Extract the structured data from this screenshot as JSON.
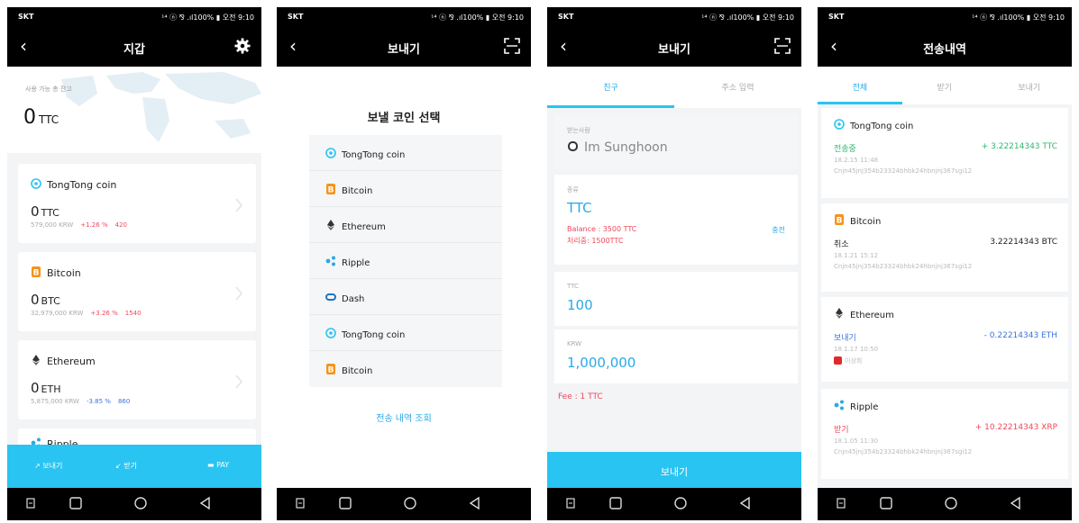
{
  "status_bar": {
    "carrier": "SKT",
    "system_info": "¹⁴ ⓝ ⅋ .ıl100% ▮ 오전 9:10"
  },
  "colors": {
    "accent": "#29c4f2",
    "positive": "#f0475a",
    "negative": "#3a74e0",
    "bitcoin": "#f7931a",
    "sending": "#2eb872"
  },
  "icons": {
    "back": "back-arrow-icon",
    "settings": "gear-icon",
    "scan": "qr-scan-icon",
    "tongtong": "tongtong-coin-icon",
    "bitcoin": "bitcoin-icon",
    "ethereum": "ethereum-icon",
    "ripple": "ripple-icon",
    "dash": "dash-icon"
  },
  "wallet": {
    "title": "지갑",
    "total_label": "사용 가능 총 잔고",
    "total_value": "0",
    "total_unit": "TTC",
    "coins": [
      {
        "name": "TongTong coin",
        "amount": "0",
        "unit": "TTC",
        "krw": "579,000 KRW",
        "change": "+1.26 %",
        "count": "420"
      },
      {
        "name": "Bitcoin",
        "amount": "0",
        "unit": "BTC",
        "krw": "32,979,000 KRW",
        "change": "+3.26 %",
        "count": "1540"
      },
      {
        "name": "Ethereum",
        "amount": "0",
        "unit": "ETH",
        "krw": "5,875,000 KRW",
        "change": "-3.85 %",
        "count": "860"
      },
      {
        "name": "Ripple"
      }
    ],
    "tabs": {
      "send": "보내기",
      "receive": "받기",
      "pay": "PAY"
    }
  },
  "coin_select": {
    "title": "보내기",
    "heading": "보낼 코인 선택",
    "coins": [
      "TongTong coin",
      "Bitcoin",
      "Ethereum",
      "Ripple",
      "Dash",
      "TongTong coin",
      "Bitcoin"
    ],
    "history_link": "전송 내역 조회"
  },
  "send": {
    "title": "보내기",
    "tab_friend": "친구",
    "tab_address": "주소 입력",
    "recipient_label": "받는사람",
    "recipient_name": "Im Sunghoon",
    "type_label": "종류",
    "type_value": "TTC",
    "balance_text": "Balance : 3500 TTC",
    "processing_text": "처리중: 1500TTC",
    "charge_link": "충전",
    "ttc_label": "TTC",
    "ttc_value": "100",
    "krw_label": "KRW",
    "krw_value": "1,000,000",
    "fee": "Fee : 1 TTC",
    "send_button": "보내기"
  },
  "history": {
    "title": "전송내역",
    "tab_all": "전체",
    "tab_receive": "받기",
    "tab_send": "보내기",
    "items": [
      {
        "coin": "TongTong coin",
        "status": "전송중",
        "amount": "+ 3.22214343 TTC",
        "date": "18.2.15 11:48",
        "address": "Cnjn45jnj354b23324bhbk24hbnjnj367sgi12"
      },
      {
        "coin": "Bitcoin",
        "status": "취소",
        "amount": "3.22214343 BTC",
        "date": "18.1.21 15:12",
        "address": "Cnjn45jnj354b23324bhbk24hbnjnj367sgi12"
      },
      {
        "coin": "Ethereum",
        "status": "보내기",
        "amount": "- 0.22214343 ETH",
        "date": "18.1.17 10:50",
        "contact": "이상희"
      },
      {
        "coin": "Ripple",
        "status": "받기",
        "amount": "+ 10.22214343 XRP",
        "date": "18.1.05 11:30",
        "address": "Cnjn45jnj354b23324bhbk24hbnjnj367sgi12"
      }
    ]
  }
}
